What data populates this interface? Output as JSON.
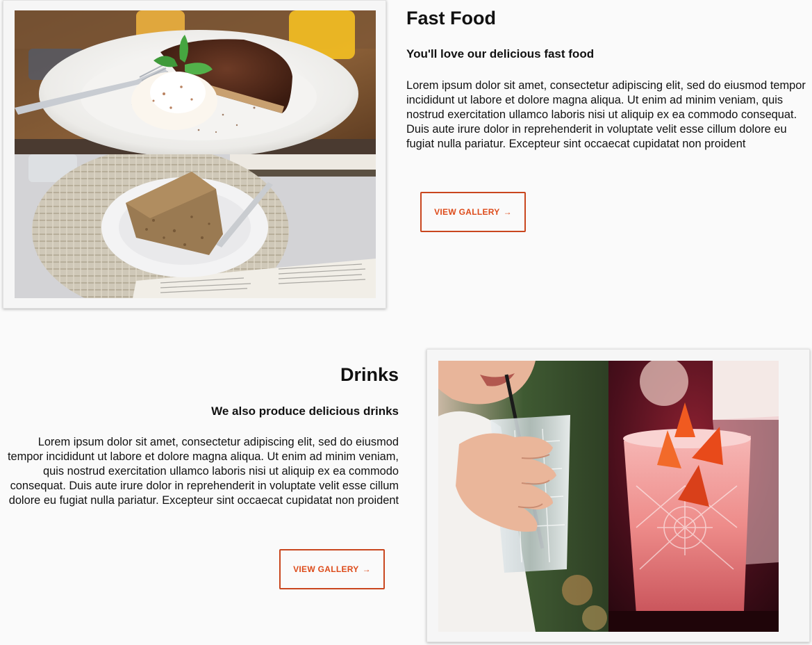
{
  "sections": {
    "fast_food": {
      "title": "Fast Food",
      "subtitle": "You'll love our delicious fast food",
      "body": "Lorem ipsum dolor sit amet, consectetur adipiscing elit, sed do eiusmod tempor incididunt ut labore et dolore magna aliqua. Ut enim ad minim veniam, quis nostrud exercitation ullamco laboris nisi ut aliquip ex ea commodo consequat. Duis aute irure dolor in reprehenderit in voluptate velit esse cillum dolore eu fugiat nulla pariatur. Excepteur sint occaecat cupidatat non proident",
      "button_label": "VIEW GALLERY",
      "button_arrow": "→",
      "images": [
        "cake-with-cream-photo",
        "crumb-cake-on-book-photo"
      ]
    },
    "drinks": {
      "title": "Drinks",
      "subtitle": "We also produce delicious drinks",
      "body": "Lorem ipsum dolor sit amet, consectetur adipiscing elit, sed do eiusmod tempor incididunt ut labore et dolore magna aliqua. Ut enim ad minim veniam, quis nostrud exercitation ullamco laboris nisi ut aliquip ex ea commodo consequat. Duis aute irure dolor in reprehenderit in voluptate velit esse cillum dolore eu fugiat nulla pariatur. Excepteur sint occaecat cupidatat non proident",
      "button_label": "VIEW GALLERY",
      "button_arrow": "→",
      "images": [
        "woman-drinking-water-photo",
        "red-cocktail-glass-photo"
      ]
    }
  },
  "colors": {
    "accent": "#dd4b1a",
    "button_border": "#c9461e",
    "page_background": "#fafafa",
    "card_background": "#f6f6f6",
    "text": "#111111"
  },
  "icons": {
    "gallery_arrow": "arrow-right-icon"
  }
}
